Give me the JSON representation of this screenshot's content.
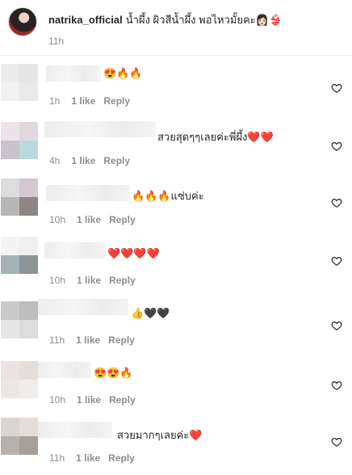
{
  "caption": {
    "username": "natrika_official",
    "text": "น้ำผึ้ง ผิวสีน้ำผึ้ง พอไหวมั้ยคะ👩🏻👙",
    "time": "11h"
  },
  "comments": [
    {
      "text": "😍🔥🔥",
      "time": "1h",
      "likes": "1 like",
      "reply": "Reply"
    },
    {
      "text": "สวยสุดๆๆเลยค่ะพี่ผึ้ง❤️❤️",
      "time": "4h",
      "likes": "1 like",
      "reply": "Reply"
    },
    {
      "text": "🔥🔥🔥แซ่บค่ะ",
      "time": "10h",
      "likes": "1 like",
      "reply": "Reply"
    },
    {
      "text": "❤️❤️❤️❤️",
      "time": "10h",
      "likes": "1 like",
      "reply": "Reply"
    },
    {
      "text": "👍🖤🖤",
      "time": "11h",
      "likes": "1 like",
      "reply": "Reply"
    },
    {
      "text": "😍😍🔥",
      "time": "10h",
      "likes": "1 like",
      "reply": "Reply"
    },
    {
      "text": "สวยมากๆเลยค่ะ❤️",
      "time": "11h",
      "likes": "1 like",
      "reply": "Reply"
    }
  ],
  "icons": {
    "like": "heart-outline-icon"
  }
}
